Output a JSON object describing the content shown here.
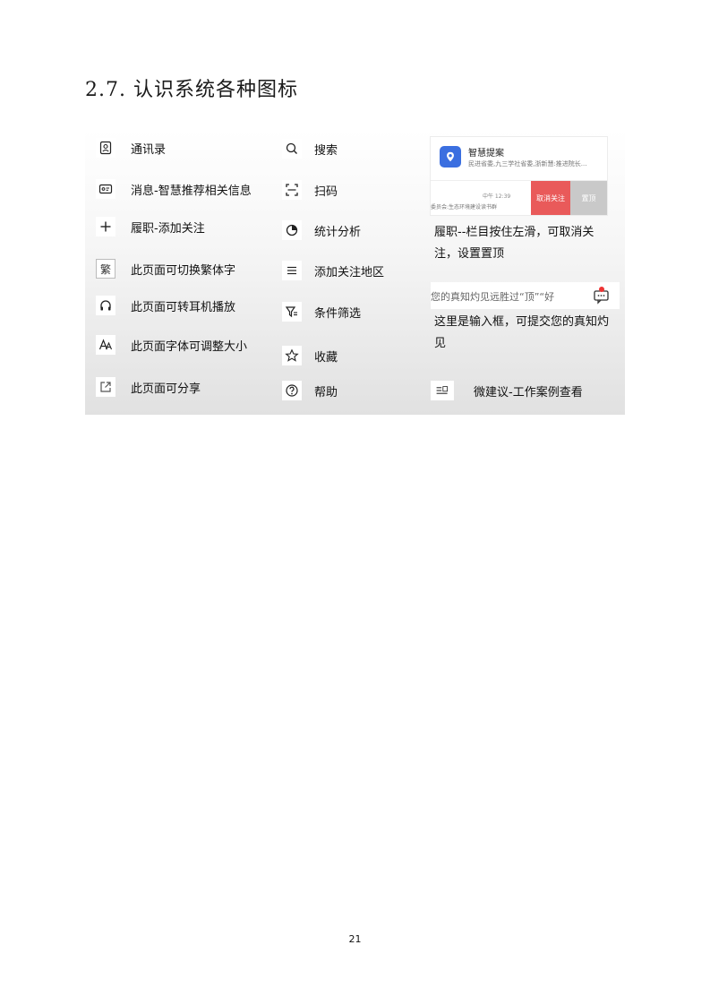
{
  "section": {
    "title": "2.7.  认识系统各种图标"
  },
  "col1": [
    {
      "label": "通讯录",
      "icon": "contacts-icon"
    },
    {
      "label": "消息-智慧推荐相关信息",
      "icon": "message-card-icon"
    },
    {
      "label": "履职-添加关注",
      "icon": "plus-icon"
    },
    {
      "label": "此页面可切换繁体字",
      "icon": "traditional-char-icon",
      "glyph": "繁"
    },
    {
      "label": "此页面可转耳机播放",
      "icon": "headphones-icon"
    },
    {
      "label": "此页面字体可调整大小",
      "icon": "font-size-icon"
    },
    {
      "label": "此页面可分享",
      "icon": "share-icon"
    }
  ],
  "col2": [
    {
      "label": "搜索",
      "icon": "search-icon"
    },
    {
      "label": "扫码",
      "icon": "scan-icon"
    },
    {
      "label": "统计分析",
      "icon": "pie-chart-icon"
    },
    {
      "label": "添加关注地区",
      "icon": "list-icon"
    },
    {
      "label": "条件筛选",
      "icon": "filter-icon"
    },
    {
      "label": "收藏",
      "icon": "star-icon"
    },
    {
      "label": "帮助",
      "icon": "help-icon"
    }
  ],
  "col3": {
    "card": {
      "name": "智慧提案",
      "sub": "民进省委,九三学社省委,浙新慧:推进院长...",
      "time": "中午 12:39",
      "sub2": "委员会:生态环境建设读书群",
      "cancel_label": "取消关注",
      "top_label": "置顶"
    },
    "swipe_desc": "履职--栏目按住左滑，可取消关注，设置置顶",
    "input": {
      "placeholder": "您的真知灼见远胜过“顶”“好"
    },
    "input_desc": "这里是输入框，可提交您的真知灼见",
    "suggest": {
      "label": "微建议-工作案例查看",
      "icon": "suggestion-icon"
    }
  },
  "colors": {
    "accent_red": "#e95a5a",
    "gray_button": "#c9c9c9",
    "app_blue": "#3b6fe0"
  },
  "page": {
    "number": "21"
  }
}
